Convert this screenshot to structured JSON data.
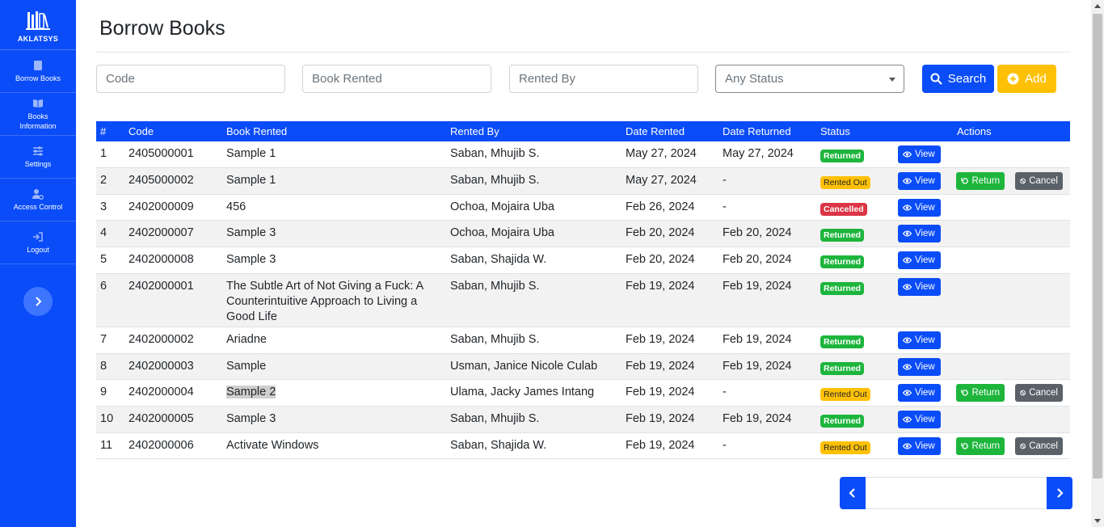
{
  "sidebar": {
    "brand": "AKLATSYS",
    "items": [
      {
        "label": "Borrow Books",
        "icon": "book-icon"
      },
      {
        "label": "Books Information",
        "icon": "open-book-icon"
      },
      {
        "label": "Settings",
        "icon": "sliders-icon"
      },
      {
        "label": "Access Control",
        "icon": "user-gear-icon"
      },
      {
        "label": "Logout",
        "icon": "logout-icon"
      }
    ],
    "toggle_icon": "chevron-right-icon"
  },
  "page": {
    "title": "Borrow Books"
  },
  "filters": {
    "code_placeholder": "Code",
    "book_placeholder": "Book Rented",
    "by_placeholder": "Rented By",
    "status_selected": "Any Status",
    "search_label": "Search",
    "add_label": "Add"
  },
  "table": {
    "headers": {
      "num": "#",
      "code": "Code",
      "book": "Book Rented",
      "by": "Rented By",
      "date_rented": "Date Rented",
      "date_returned": "Date Returned",
      "status": "Status",
      "actions": "Actions"
    },
    "buttons": {
      "view": "View",
      "return": "Return",
      "cancel": "Cancel"
    },
    "rows": [
      {
        "num": "1",
        "code": "2405000001",
        "book": "Sample 1",
        "by": "Saban, Mhujib S.",
        "date_rented": "May 27, 2024",
        "date_returned": "May 27, 2024",
        "status": "Returned"
      },
      {
        "num": "2",
        "code": "2405000002",
        "book": "Sample 1",
        "by": "Saban, Mhujib S.",
        "date_rented": "May 27, 2024",
        "date_returned": "-",
        "status": "Rented Out"
      },
      {
        "num": "3",
        "code": "2402000009",
        "book": "456",
        "by": "Ochoa, Mojaira Uba",
        "date_rented": "Feb 26, 2024",
        "date_returned": "-",
        "status": "Cancelled"
      },
      {
        "num": "4",
        "code": "2402000007",
        "book": "Sample 3",
        "by": "Ochoa, Mojaira Uba",
        "date_rented": "Feb 20, 2024",
        "date_returned": "Feb 20, 2024",
        "status": "Returned"
      },
      {
        "num": "5",
        "code": "2402000008",
        "book": "Sample 3",
        "by": "Saban, Shajida W.",
        "date_rented": "Feb 20, 2024",
        "date_returned": "Feb 20, 2024",
        "status": "Returned"
      },
      {
        "num": "6",
        "code": "2402000001",
        "book": "The Subtle Art of Not Giving a Fuck: A Counterintuitive Approach to Living a Good Life",
        "by": "Saban, Mhujib S.",
        "date_rented": "Feb 19, 2024",
        "date_returned": "Feb 19, 2024",
        "status": "Returned"
      },
      {
        "num": "7",
        "code": "2402000002",
        "book": "Ariadne",
        "by": "Saban, Mhujib S.",
        "date_rented": "Feb 19, 2024",
        "date_returned": "Feb 19, 2024",
        "status": "Returned"
      },
      {
        "num": "8",
        "code": "2402000003",
        "book": "Sample",
        "by": "Usman, Janice Nicole Culab",
        "date_rented": "Feb 19, 2024",
        "date_returned": "Feb 19, 2024",
        "status": "Returned"
      },
      {
        "num": "9",
        "code": "2402000004",
        "book": "Sample 2",
        "by": "Ulama, Jacky James Intang",
        "date_rented": "Feb 19, 2024",
        "date_returned": "-",
        "status": "Rented Out"
      },
      {
        "num": "10",
        "code": "2402000005",
        "book": "Sample 3",
        "by": "Saban, Mhujib S.",
        "date_rented": "Feb 19, 2024",
        "date_returned": "Feb 19, 2024",
        "status": "Returned"
      },
      {
        "num": "11",
        "code": "2402000006",
        "book": "Activate Windows",
        "by": "Saban, Shajida W.",
        "date_rented": "Feb 19, 2024",
        "date_returned": "-",
        "status": "Rented Out"
      }
    ]
  },
  "colors": {
    "primary": "#0a4cf8",
    "success": "#1db53c",
    "warning": "#ffc107",
    "danger": "#dc3545",
    "secondary": "#5a6168"
  }
}
